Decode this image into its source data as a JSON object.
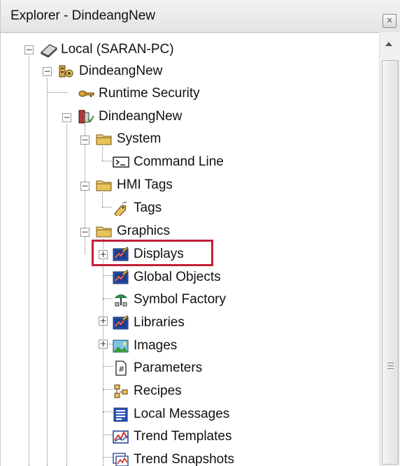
{
  "window": {
    "title": "Explorer - DindeangNew",
    "close_glyph": "×"
  },
  "tree": {
    "items": [
      {
        "label": "Local (SARAN-PC)",
        "icon": "local-computer-icon",
        "expander": "−"
      },
      {
        "label": "DindeangNew",
        "icon": "application-icon",
        "expander": "−"
      },
      {
        "label": "Runtime Security",
        "icon": "key-icon"
      },
      {
        "label": "DindeangNew",
        "icon": "area-server-icon",
        "expander": "−"
      },
      {
        "label": "System",
        "icon": "folder-icon",
        "expander": "−"
      },
      {
        "label": "Command Line",
        "icon": "command-line-icon"
      },
      {
        "label": "HMI Tags",
        "icon": "folder-icon",
        "expander": "−"
      },
      {
        "label": "Tags",
        "icon": "tags-icon"
      },
      {
        "label": "Graphics",
        "icon": "folder-icon",
        "expander": "−"
      },
      {
        "label": "Displays",
        "icon": "displays-icon",
        "expander": "+",
        "highlighted": true
      },
      {
        "label": "Global Objects",
        "icon": "global-objects-icon"
      },
      {
        "label": "Symbol Factory",
        "icon": "symbol-factory-icon"
      },
      {
        "label": "Libraries",
        "icon": "libraries-icon",
        "expander": "+"
      },
      {
        "label": "Images",
        "icon": "images-icon",
        "expander": "+"
      },
      {
        "label": "Parameters",
        "icon": "parameters-icon"
      },
      {
        "label": "Recipes",
        "icon": "recipes-icon"
      },
      {
        "label": "Local Messages",
        "icon": "local-messages-icon"
      },
      {
        "label": "Trend Templates",
        "icon": "trend-templates-icon"
      },
      {
        "label": "Trend Snapshots",
        "icon": "trend-snapshots-icon"
      }
    ]
  },
  "colors": {
    "highlight_border": "#c0203a",
    "folder": "#e8c35a",
    "display_blue": "#2a56b8"
  }
}
